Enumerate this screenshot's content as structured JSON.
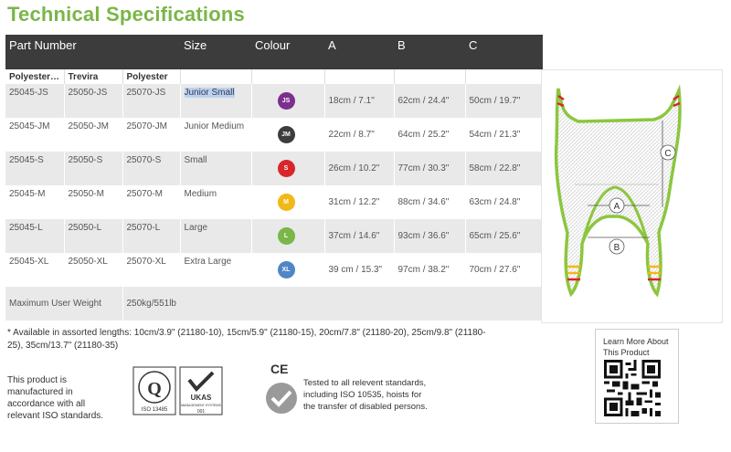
{
  "title": "Technical Specifications",
  "table": {
    "header": {
      "part_number": "Part Number",
      "size": "Size",
      "colour": "Colour",
      "a": "A",
      "b": "B",
      "c": "C"
    },
    "subheader": {
      "polyester_net": "Polyester Net",
      "trevira": "Trevira",
      "polyester": "Polyester"
    },
    "rows": [
      {
        "pn": "25045-JS",
        "tr": "25050-JS",
        "po": "25070-JS",
        "size": "Junior Small",
        "badge": "JS",
        "color": "#7b2f8e",
        "a": "18cm / 7.1\"",
        "b": "62cm / 24.4\"",
        "c": "50cm / 19.7\""
      },
      {
        "pn": "25045-JM",
        "tr": "25050-JM",
        "po": "25070-JM",
        "size": "Junior Medium",
        "badge": "JM",
        "color": "#3d3d3d",
        "a": "22cm / 8.7\"",
        "b": "64cm / 25.2\"",
        "c": "54cm / 21.3\""
      },
      {
        "pn": "25045-S",
        "tr": "25050-S",
        "po": "25070-S",
        "size": "Small",
        "badge": "S",
        "color": "#d9262a",
        "a": "26cm / 10.2\"",
        "b": "77cm / 30.3\"",
        "c": "58cm / 22.8\""
      },
      {
        "pn": "25045-M",
        "tr": "25050-M",
        "po": "25070-M",
        "size": "Medium",
        "badge": "M",
        "color": "#f2b817",
        "a": "31cm / 12.2\"",
        "b": "88cm / 34.6\"",
        "c": "63cm / 24.8\""
      },
      {
        "pn": "25045-L",
        "tr": "25050-L",
        "po": "25070-L",
        "size": "Large",
        "badge": "L",
        "color": "#7ab648",
        "a": "37cm / 14.6\"",
        "b": "93cm / 36.6\"",
        "c": "65cm / 25.6\""
      },
      {
        "pn": "25045-XL",
        "tr": "25050-XL",
        "po": "25070-XL",
        "size": "Extra Large",
        "badge": "XL",
        "color": "#4f86c6",
        "a": "39 cm / 15.3\"",
        "b": "97cm / 38.2\"",
        "c": "70cm / 27.6\""
      }
    ],
    "max_weight_label": "Maximum User Weight",
    "max_weight_value": "250kg/551lb"
  },
  "diagram": {
    "label_a": "A",
    "label_b": "B",
    "label_c": "C"
  },
  "footnote": "* Available in assorted lengths: 10cm/3.9\" (21180-10), 15cm/5.9\" (21180-15), 20cm/7.8\" (21180-20), 25cm/9.8\" (21180-25), 35cm/13.7\" (21180-35)",
  "manufactured": "This product is manufactured in accordance with all relevant ISO standards.",
  "cert": {
    "iso": "ISO 13485",
    "ukas": "UKAS",
    "ukas_sub": "MANAGEMENT SYSTEMS",
    "ukas_num": "001"
  },
  "ce_mark": "CE",
  "tested": "Tested to all relevent standards, including ISO 10535, hoists for the transfer of disabled persons.",
  "qr_label": "Learn More About This Product"
}
